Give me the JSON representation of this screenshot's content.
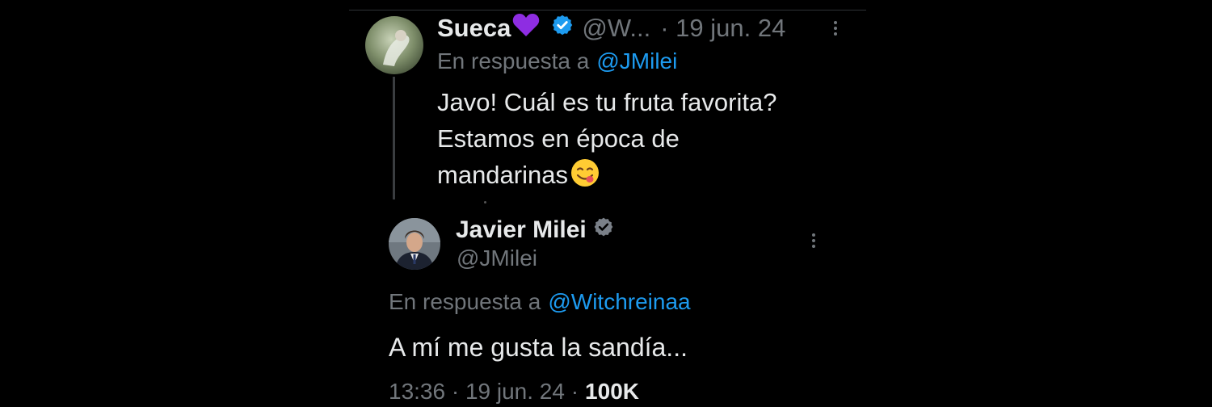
{
  "colors": {
    "background": "#000000",
    "text": "#e7e9ea",
    "muted": "#71767b",
    "link": "#1d9bf0",
    "verified": "#1d9bf0",
    "heart": "#8e2de2"
  },
  "reply_to_tweet": {
    "author_name": "Sueca",
    "author_emoji": "purple-heart-icon",
    "handle": "@W...",
    "date": "· 19 jun. 24",
    "in_reply_prefix": "En respuesta a",
    "in_reply_handle": "@JMilei",
    "lines": [
      "Javo! Cuál es tu fruta favorita?",
      "Estamos en época de",
      "mandarinas"
    ],
    "emoji": "savoring-food-face-icon"
  },
  "main_tweet": {
    "author_name": "Javier Milei",
    "handle": "@JMilei",
    "in_reply_prefix": "En respuesta a",
    "in_reply_handle": "@Witchreinaa",
    "text": "A mí me gusta la sandía...",
    "meta_time": "13:36 · 19 jun. 24 ·",
    "meta_views": "100K"
  }
}
